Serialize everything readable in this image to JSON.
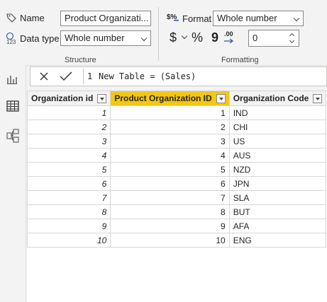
{
  "ribbon": {
    "structure": {
      "name_label": "Name",
      "name_value": "Product Organizati...",
      "datatype_label": "Data type",
      "datatype_value": "Whole number",
      "caption": "Structure"
    },
    "formatting": {
      "format_label": "Format",
      "format_value": "Whole number",
      "currency_symbol": "$",
      "percent_symbol": "%",
      "comma_symbol": "9",
      "decimal_symbol": ".00",
      "decimal_places": "0",
      "caption": "Formatting"
    }
  },
  "formula_bar": {
    "line_number": "1",
    "text": "New Table = (Sales)"
  },
  "table": {
    "columns": [
      "Organization id",
      "Product Organization ID",
      "Organization Code"
    ],
    "rows": [
      [
        "1",
        "1",
        "IND"
      ],
      [
        "2",
        "2",
        "CHI"
      ],
      [
        "3",
        "3",
        "US"
      ],
      [
        "4",
        "4",
        "AUS"
      ],
      [
        "5",
        "5",
        "NZD"
      ],
      [
        "6",
        "6",
        "JPN"
      ],
      [
        "7",
        "7",
        "SLA"
      ],
      [
        "8",
        "8",
        "BUT"
      ],
      [
        "9",
        "9",
        "AFA"
      ],
      [
        "10",
        "10",
        "ENG"
      ]
    ]
  },
  "colors": {
    "selected_header": "#f2c811",
    "accent": "#f2c811"
  }
}
